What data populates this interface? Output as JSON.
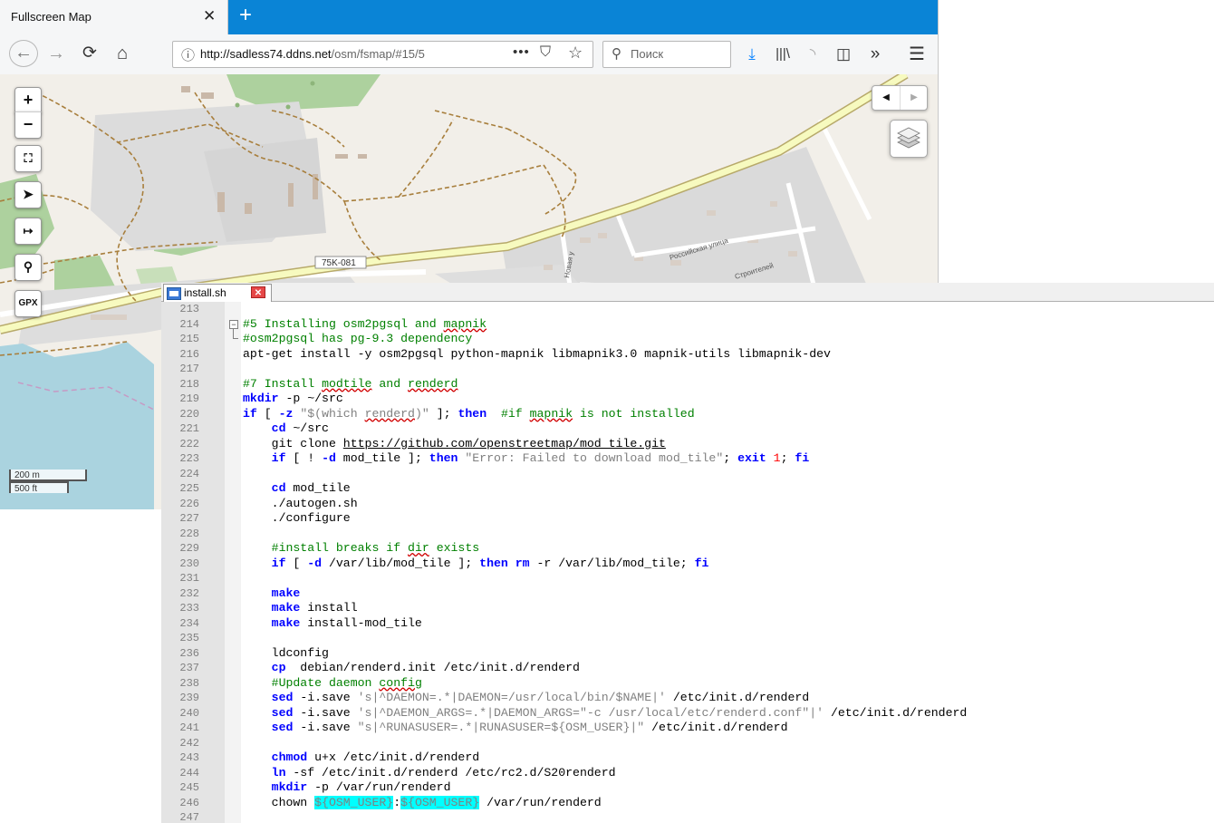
{
  "browser": {
    "tab_title": "Fullscreen Map",
    "url_host": "http://sadless74.ddns.net",
    "url_path": "/osm/fsmap/#15/5",
    "search_placeholder": "Поиск"
  },
  "map": {
    "road_label": "75K-081",
    "street_1": "Российская улица",
    "street_2": "Строителей",
    "street_3": "Новая у",
    "scale_metric": "200 m",
    "scale_imperial": "500 ft",
    "controls": {
      "zoom_in": "+",
      "zoom_out": "−",
      "gpx": "GPX"
    }
  },
  "editor": {
    "filename": "install.sh",
    "lines": [
      {
        "n": "213",
        "s": []
      },
      {
        "n": "214",
        "s": [
          {
            "t": "#5 Installing osm2pgsql and ",
            "c": "c-com"
          },
          {
            "t": "mapnik",
            "c": "c-com c-sq"
          }
        ]
      },
      {
        "n": "215",
        "s": [
          {
            "t": "#osm2pgsql has pg-9.3 dependency",
            "c": "c-com"
          }
        ]
      },
      {
        "n": "216",
        "s": [
          {
            "t": "apt-get install -y osm2pgsql python-mapnik libmapnik3.0 mapnik-utils libmapnik-dev"
          }
        ]
      },
      {
        "n": "217",
        "s": []
      },
      {
        "n": "218",
        "s": [
          {
            "t": "#7 Install ",
            "c": "c-com"
          },
          {
            "t": "modtile",
            "c": "c-com c-sq"
          },
          {
            "t": " and ",
            "c": "c-com"
          },
          {
            "t": "renderd",
            "c": "c-com c-sq"
          }
        ]
      },
      {
        "n": "219",
        "s": [
          {
            "t": "mkdir",
            "c": "c-kw"
          },
          {
            "t": " -p ~/src"
          }
        ]
      },
      {
        "n": "220",
        "s": [
          {
            "t": "if",
            "c": "c-kw"
          },
          {
            "t": " [ "
          },
          {
            "t": "-z",
            "c": "c-kw"
          },
          {
            "t": " "
          },
          {
            "t": "\"$(which ",
            "c": "c-str"
          },
          {
            "t": "renderd",
            "c": "c-str c-sq"
          },
          {
            "t": ")\"",
            "c": "c-str"
          },
          {
            "t": " ]; "
          },
          {
            "t": "then",
            "c": "c-kw"
          },
          {
            "t": "  "
          },
          {
            "t": "#if ",
            "c": "c-com"
          },
          {
            "t": "mapnik",
            "c": "c-com c-sq"
          },
          {
            "t": " is not installed",
            "c": "c-com"
          }
        ]
      },
      {
        "n": "221",
        "s": [
          {
            "t": "    "
          },
          {
            "t": "cd",
            "c": "c-kw"
          },
          {
            "t": " ~/src"
          }
        ]
      },
      {
        "n": "222",
        "s": [
          {
            "t": "    git clone "
          },
          {
            "t": "https://github.com/openstreetmap/mod_tile.git",
            "c": "c-url"
          }
        ]
      },
      {
        "n": "223",
        "s": [
          {
            "t": "    "
          },
          {
            "t": "if",
            "c": "c-kw"
          },
          {
            "t": " [ ! "
          },
          {
            "t": "-d",
            "c": "c-kw"
          },
          {
            "t": " mod_tile ]; "
          },
          {
            "t": "then",
            "c": "c-kw"
          },
          {
            "t": " "
          },
          {
            "t": "\"Error: Failed to download mod_tile\"",
            "c": "c-str"
          },
          {
            "t": "; "
          },
          {
            "t": "exit",
            "c": "c-kw"
          },
          {
            "t": " "
          },
          {
            "t": "1",
            "c": "c-num"
          },
          {
            "t": "; "
          },
          {
            "t": "fi",
            "c": "c-kw"
          }
        ]
      },
      {
        "n": "224",
        "s": []
      },
      {
        "n": "225",
        "s": [
          {
            "t": "    "
          },
          {
            "t": "cd",
            "c": "c-kw"
          },
          {
            "t": " mod_tile"
          }
        ]
      },
      {
        "n": "226",
        "s": [
          {
            "t": "    ./autogen.sh"
          }
        ]
      },
      {
        "n": "227",
        "s": [
          {
            "t": "    ./configure"
          }
        ]
      },
      {
        "n": "228",
        "s": []
      },
      {
        "n": "229",
        "s": [
          {
            "t": "    "
          },
          {
            "t": "#install breaks if ",
            "c": "c-com"
          },
          {
            "t": "dir",
            "c": "c-com c-sq"
          },
          {
            "t": " exists",
            "c": "c-com"
          }
        ]
      },
      {
        "n": "230",
        "s": [
          {
            "t": "    "
          },
          {
            "t": "if",
            "c": "c-kw"
          },
          {
            "t": " [ "
          },
          {
            "t": "-d",
            "c": "c-kw"
          },
          {
            "t": " /var/lib/mod_tile ]; "
          },
          {
            "t": "then",
            "c": "c-kw"
          },
          {
            "t": " "
          },
          {
            "t": "rm",
            "c": "c-kw"
          },
          {
            "t": " -r /var/lib/mod_tile; "
          },
          {
            "t": "fi",
            "c": "c-kw"
          }
        ]
      },
      {
        "n": "231",
        "s": []
      },
      {
        "n": "232",
        "s": [
          {
            "t": "    "
          },
          {
            "t": "make",
            "c": "c-kw"
          }
        ]
      },
      {
        "n": "233",
        "s": [
          {
            "t": "    "
          },
          {
            "t": "make",
            "c": "c-kw"
          },
          {
            "t": " install"
          }
        ]
      },
      {
        "n": "234",
        "s": [
          {
            "t": "    "
          },
          {
            "t": "make",
            "c": "c-kw"
          },
          {
            "t": " install-mod_tile"
          }
        ]
      },
      {
        "n": "235",
        "s": []
      },
      {
        "n": "236",
        "s": [
          {
            "t": "    ldconfig"
          }
        ]
      },
      {
        "n": "237",
        "s": [
          {
            "t": "    "
          },
          {
            "t": "cp",
            "c": "c-kw"
          },
          {
            "t": "  debian/renderd.init /etc/init.d/renderd"
          }
        ]
      },
      {
        "n": "238",
        "s": [
          {
            "t": "    "
          },
          {
            "t": "#Update daemon ",
            "c": "c-com"
          },
          {
            "t": "config",
            "c": "c-com c-sq"
          }
        ]
      },
      {
        "n": "239",
        "s": [
          {
            "t": "    "
          },
          {
            "t": "sed",
            "c": "c-kw"
          },
          {
            "t": " -i.save "
          },
          {
            "t": "'s|^DAEMON=.*|DAEMON=/usr/local/bin/$NAME|'",
            "c": "c-str"
          },
          {
            "t": " /etc/init.d/renderd"
          }
        ]
      },
      {
        "n": "240",
        "s": [
          {
            "t": "    "
          },
          {
            "t": "sed",
            "c": "c-kw"
          },
          {
            "t": " -i.save "
          },
          {
            "t": "'s|^DAEMON_ARGS=.*|DAEMON_ARGS=\"-c /usr/local/etc/renderd.conf\"|'",
            "c": "c-str"
          },
          {
            "t": " /etc/init.d/renderd"
          }
        ]
      },
      {
        "n": "241",
        "s": [
          {
            "t": "    "
          },
          {
            "t": "sed",
            "c": "c-kw"
          },
          {
            "t": " -i.save "
          },
          {
            "t": "\"s|^RUNASUSER=.*|RUNASUSER=${OSM_USER}|\"",
            "c": "c-str"
          },
          {
            "t": " /etc/init.d/renderd"
          }
        ]
      },
      {
        "n": "242",
        "s": []
      },
      {
        "n": "243",
        "s": [
          {
            "t": "    "
          },
          {
            "t": "chmod",
            "c": "c-kw"
          },
          {
            "t": " u+x /etc/init.d/renderd"
          }
        ]
      },
      {
        "n": "244",
        "s": [
          {
            "t": "    "
          },
          {
            "t": "ln",
            "c": "c-kw"
          },
          {
            "t": " -sf /etc/init.d/renderd /etc/rc2.d/S20renderd"
          }
        ]
      },
      {
        "n": "245",
        "s": [
          {
            "t": "    "
          },
          {
            "t": "mkdir",
            "c": "c-kw"
          },
          {
            "t": " -p /var/run/renderd"
          }
        ]
      },
      {
        "n": "246",
        "s": [
          {
            "t": "    chown "
          },
          {
            "t": "${OSM_USER}",
            "c": "c-hl"
          },
          {
            "t": ":"
          },
          {
            "t": "${OSM_USER}",
            "c": "c-hl"
          },
          {
            "t": " /var/run/renderd"
          }
        ]
      },
      {
        "n": "247",
        "s": []
      }
    ]
  }
}
